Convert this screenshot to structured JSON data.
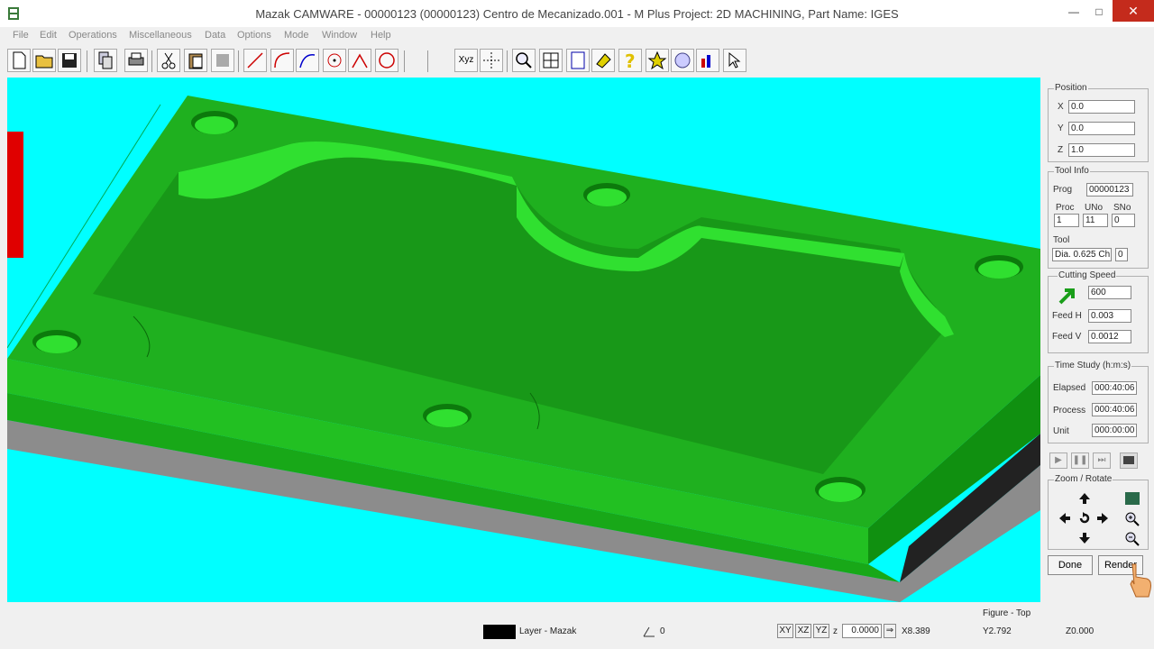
{
  "window": {
    "title": "Mazak CAMWARE - 00000123 (00000123) Centro de Mecanizado.001 - M Plus Project: 2D MACHINING, Part Name: IGES",
    "minimize": "—",
    "maximize": "□",
    "close": "✕"
  },
  "menu": [
    "File",
    "Edit",
    "Operations",
    "Miscellaneous",
    "Data",
    "Options",
    "Mode",
    "Window",
    "Help"
  ],
  "toolbar": {
    "xyz_label": "Xyz"
  },
  "panel": {
    "position": {
      "title": "Position",
      "x_label": "X",
      "x_value": "0.0",
      "y_label": "Y",
      "y_value": "0.0",
      "z_label": "Z",
      "z_value": "1.0"
    },
    "tool_info": {
      "title": "Tool Info",
      "prog_label": "Prog",
      "prog_value": "00000123",
      "proc_label": "Proc",
      "proc_value": "1",
      "uno_label": "UNo",
      "uno_value": "11",
      "sno_label": "SNo",
      "sno_value": "0",
      "tool_label": "Tool",
      "tool_value": "Dia. 0.625 Ch",
      "tool_extra": "0"
    },
    "cutting_speed": {
      "title": "Cutting Speed",
      "speed_value": "600",
      "feedh_label": "Feed H",
      "feedh_value": "0.003",
      "feedv_label": "Feed V",
      "feedv_value": "0.0012"
    },
    "time_study": {
      "title": "Time Study (h:m:s)",
      "elapsed_label": "Elapsed",
      "elapsed_value": "000:40:06",
      "process_label": "Process",
      "process_value": "000:40:06",
      "unit_label": "Unit",
      "unit_value": "000:00:00"
    },
    "playback": {
      "play": "▶",
      "pause": "❚❚",
      "step": "⏭"
    },
    "zoom": {
      "title": "Zoom / Rotate"
    },
    "done_label": "Done",
    "render_label": "Render"
  },
  "status": {
    "layer_label": "Layer - Mazak",
    "angle_value": "0",
    "xy_label": "XY",
    "xz_label": "XZ",
    "yz_label": "YZ",
    "z_label": "z",
    "z_input": "0.0000",
    "figure_label": "Figure - Top",
    "x_coord": "X8.389",
    "y_coord": "Y2.792",
    "z_coord": "Z0.000"
  },
  "colors": {
    "viewport_bg": "#00ffff",
    "part_green": "#1ebd1e",
    "part_top": "#1fb61f",
    "pocket_floor": "#1a9e1a",
    "side_dark": "#2b2b2b",
    "base_grey": "#8c8c8c",
    "tool_red": "#e00000"
  },
  "icons": [
    "new-file-icon",
    "open-folder-icon",
    "save-icon",
    "copy-doc-icon",
    "print-icon",
    "cut-icon",
    "paste-icon",
    "grey-icon",
    "line-icon",
    "arc-icon",
    "curve-icon",
    "circle-point-icon",
    "angle-icon",
    "circle-icon",
    "xyz-icon",
    "grid-icon",
    "magnify-icon",
    "window-icon",
    "doc-icon",
    "eraser-icon",
    "help-icon",
    "star-icon",
    "globe-icon",
    "chart-icon",
    "pointer-icon"
  ]
}
